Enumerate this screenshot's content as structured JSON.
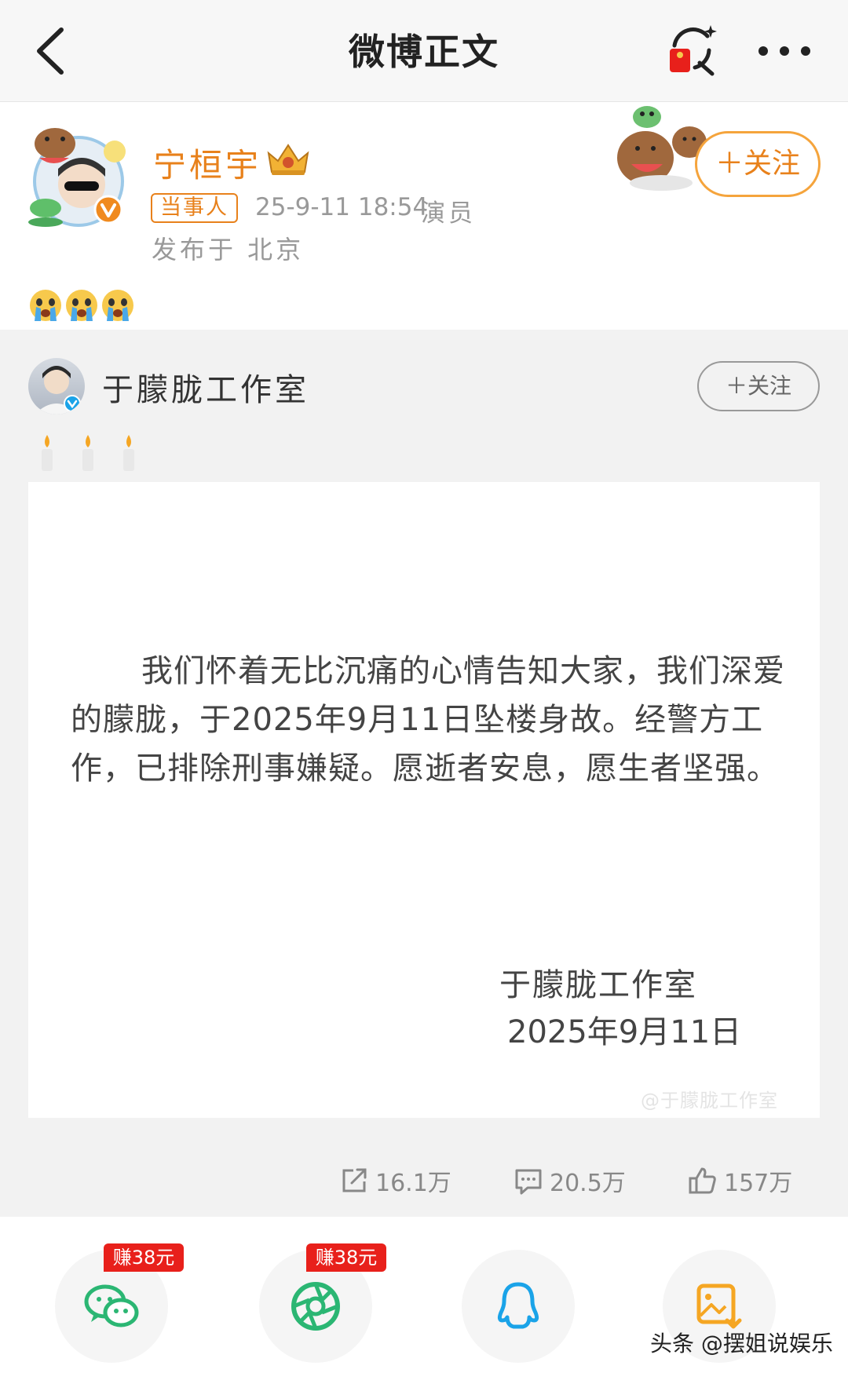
{
  "nav": {
    "title": "微博正文"
  },
  "author": {
    "name": "宁桓宇",
    "tag": "当事人",
    "time": "25-9-11 18:54",
    "role": "演员",
    "location": "发布于 北京",
    "follow_label": "＋关注",
    "emoji_icons": [
      "crying-face-icon",
      "crying-face-icon",
      "crying-face-icon"
    ]
  },
  "repost": {
    "name": "于朦胧工作室",
    "follow_label": "＋关注",
    "candle_icons": [
      "candle-icon",
      "candle-icon",
      "candle-icon"
    ],
    "statement": "我们怀着无比沉痛的心情告知大家，我们深爱的朦胧，于2025年9月11日坠楼身故。经警方工作，已排除刑事嫌疑。愿逝者安息，愿生者坚强。",
    "sign_name": "于朦胧工作室",
    "sign_date": "2025年9月11日",
    "watermark": "@于朦胧工作室"
  },
  "stats": {
    "reposts": "16.1万",
    "comments": "20.5万",
    "likes": "157万"
  },
  "share": {
    "badge_wechat": "赚38元",
    "badge_moments": "赚38元"
  },
  "credit": "头条 @摆姐说娱乐",
  "colors": {
    "accent_orange": "#e8811b",
    "badge_red": "#e8201b",
    "wechat_green": "#2bb673",
    "qq_blue": "#1aa3e8"
  }
}
